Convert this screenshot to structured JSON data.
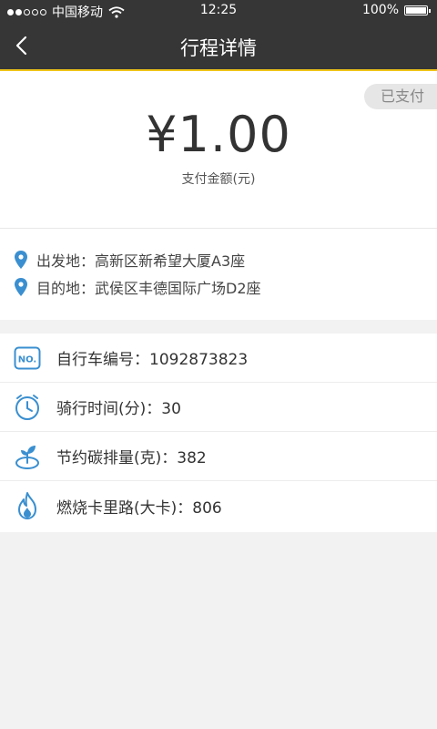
{
  "status_bar": {
    "carrier": "中国移动",
    "time": "12:25",
    "battery": "100%"
  },
  "nav": {
    "title": "行程详情"
  },
  "summary": {
    "status_badge": "已支付",
    "amount": "¥1.00",
    "amount_label": "支付金额(元)"
  },
  "route": {
    "from": "出发地：高新区新希望大厦A3座",
    "to": "目的地：武侯区丰德国际广场D2座"
  },
  "details": {
    "bike_number": "自行车编号：1092873823",
    "ride_time": "骑行时间(分)：30",
    "carbon": "节约碳排量(克)：382",
    "calories": "燃烧卡里路(大卡)：806"
  },
  "colors": {
    "accent_blue": "#3a8fd0",
    "nav_bg": "#363636",
    "nav_underline": "#f0c419"
  },
  "icons": [
    "signal-dots-icon",
    "wifi-icon",
    "battery-icon",
    "back-arrow-icon",
    "location-pin-icon",
    "bike-number-icon",
    "clock-icon",
    "leaf-icon",
    "flame-icon"
  ]
}
